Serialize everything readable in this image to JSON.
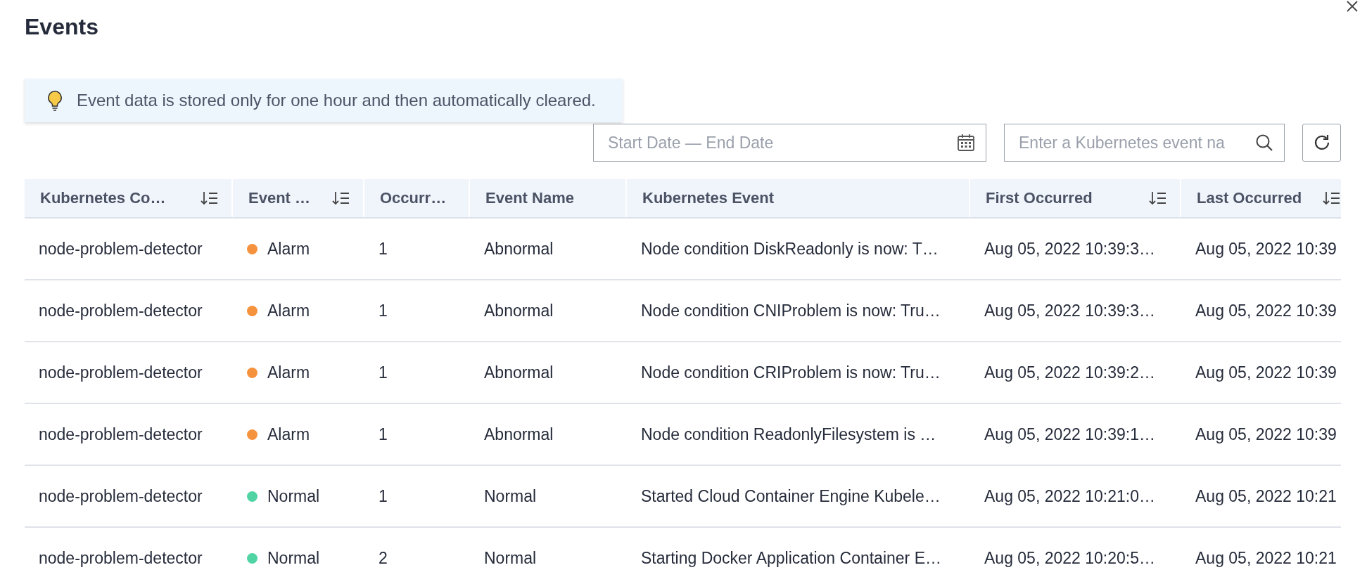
{
  "dialog": {
    "title": "Events"
  },
  "tip": {
    "text": "Event data is stored only for one hour and then automatically cleared."
  },
  "date_range": {
    "placeholder": "Start Date — End Date"
  },
  "search": {
    "placeholder": "Enter a Kubernetes event na"
  },
  "table": {
    "columns": [
      {
        "label": "Kubernetes Co…",
        "sortable": true
      },
      {
        "label": "Event …",
        "sortable": true
      },
      {
        "label": "Occurr…",
        "sortable": false
      },
      {
        "label": "Event Name",
        "sortable": false
      },
      {
        "label": "Kubernetes Event",
        "sortable": false
      },
      {
        "label": "First Occurred",
        "sortable": true
      },
      {
        "label": "Last Occurred",
        "sortable": true
      }
    ],
    "rows": [
      {
        "source": "node-problem-detector",
        "type": "Alarm",
        "color": "#f5923e",
        "count": "1",
        "name": "Abnormal",
        "event": "Node condition DiskReadonly is now: T…",
        "first": "Aug 05, 2022 10:39:3…",
        "last": "Aug 05, 2022 10:39"
      },
      {
        "source": "node-problem-detector",
        "type": "Alarm",
        "color": "#f5923e",
        "count": "1",
        "name": "Abnormal",
        "event": "Node condition CNIProblem is now: Tru…",
        "first": "Aug 05, 2022 10:39:3…",
        "last": "Aug 05, 2022 10:39"
      },
      {
        "source": "node-problem-detector",
        "type": "Alarm",
        "color": "#f5923e",
        "count": "1",
        "name": "Abnormal",
        "event": "Node condition CRIProblem is now: Tru…",
        "first": "Aug 05, 2022 10:39:2…",
        "last": "Aug 05, 2022 10:39"
      },
      {
        "source": "node-problem-detector",
        "type": "Alarm",
        "color": "#f5923e",
        "count": "1",
        "name": "Abnormal",
        "event": "Node condition ReadonlyFilesystem is …",
        "first": "Aug 05, 2022 10:39:1…",
        "last": "Aug 05, 2022 10:39"
      },
      {
        "source": "node-problem-detector",
        "type": "Normal",
        "color": "#50d4a4",
        "count": "1",
        "name": "Normal",
        "event": "Started Cloud Container Engine Kubele…",
        "first": "Aug 05, 2022 10:21:0…",
        "last": "Aug 05, 2022 10:21"
      },
      {
        "source": "node-problem-detector",
        "type": "Normal",
        "color": "#50d4a4",
        "count": "2",
        "name": "Normal",
        "event": "Starting Docker Application Container E…",
        "first": "Aug 05, 2022 10:20:5…",
        "last": "Aug 05, 2022 10:21"
      }
    ]
  }
}
